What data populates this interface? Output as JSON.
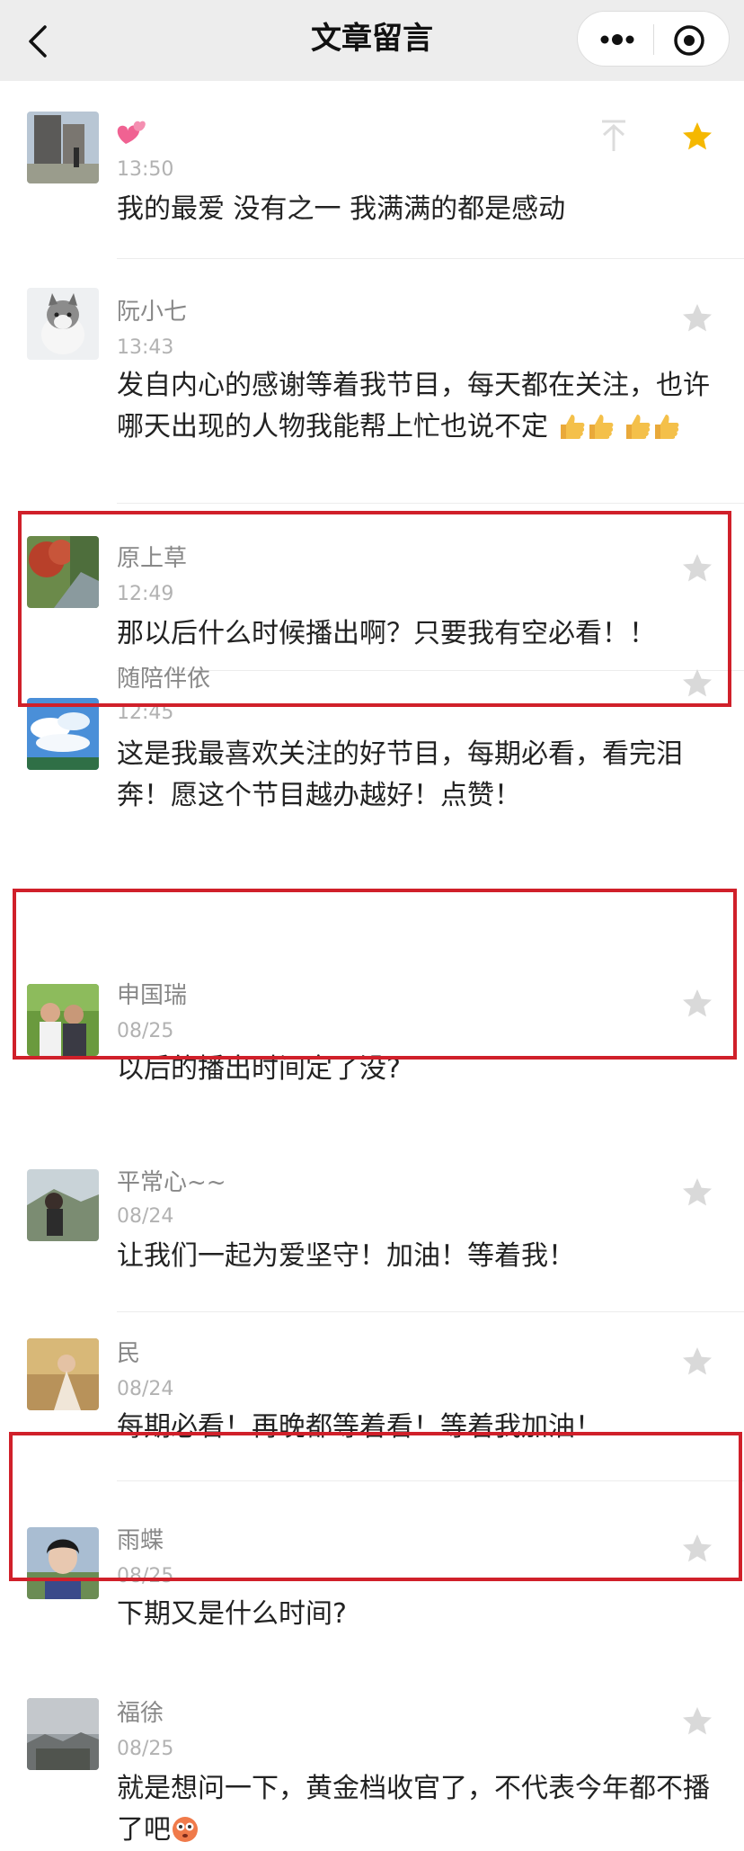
{
  "header": {
    "title": "文章留言",
    "back_icon": "chevron-left-icon",
    "more_icon": "more-dots-icon",
    "close_icon": "target-circle-icon"
  },
  "colors": {
    "highlight": "#d0202a",
    "star_active": "#f5b800",
    "star_inactive": "#d9d9d9",
    "header_bg": "#ededed"
  },
  "comments": [
    {
      "name": "",
      "name_icon": "pink-hearts-emoji",
      "time": "13:50",
      "text": "我的最爱 没有之一 我满满的都是感动",
      "starred": true,
      "pinned_icon": "pin-top-icon"
    },
    {
      "name": "阮小七",
      "time": "13:43",
      "text": "发自内心的感谢等着我节目，每天都在关注，也许哪天出现的人物我能帮上忙也说不定",
      "emoji": [
        "thumbs-up-emoji",
        "thumbs-up-emoji",
        "thumbs-up-emoji",
        "thumbs-up-emoji"
      ],
      "starred": false
    },
    {
      "name": "原上草",
      "time": "12:49",
      "text": "那以后什么时候播出啊？只要我有空必看！！",
      "starred": false,
      "highlighted": true
    },
    {
      "name": "随陪伴依",
      "time": "12:45",
      "text": "这是我最喜欢关注的好节目，每期必看，看完泪奔！愿这个节目越办越好！点赞！",
      "starred": false
    },
    {
      "name": "申国瑞",
      "time": "08/25",
      "text": "以后的播出时间定了没?",
      "starred": false,
      "highlighted": true
    },
    {
      "name": "平常心~~",
      "time": "08/24",
      "text": "让我们一起为爱坚守！加油！等着我！",
      "starred": false
    },
    {
      "name": "民",
      "time": "08/24",
      "text": "每期必看！再晚都等着看！等着我加油！",
      "starred": false
    },
    {
      "name": "雨蝶",
      "time": "08/25",
      "text": "下期又是什么时间?",
      "starred": false,
      "highlighted": true
    },
    {
      "name": "福徐",
      "time": "08/25",
      "text": "就是想问一下，黄金档收官了，不代表今年都不播了吧",
      "emoji": [
        "flushed-face-emoji"
      ],
      "starred": false
    }
  ]
}
